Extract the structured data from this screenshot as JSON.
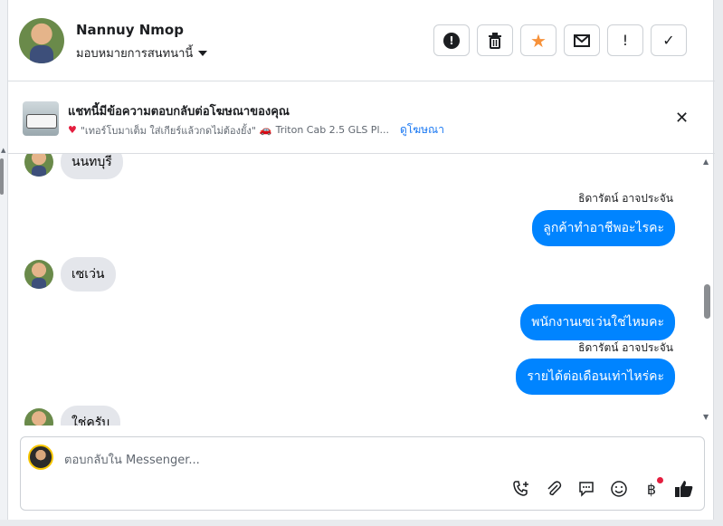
{
  "header": {
    "name": "Nannuy Nmop",
    "assign_label": "มอบหมายการสนทนานี้",
    "actions": [
      {
        "icon": "alert-circle-icon",
        "glyph": "!"
      },
      {
        "icon": "trash-icon",
        "glyph": "🗑"
      },
      {
        "icon": "star-icon",
        "glyph": "★"
      },
      {
        "icon": "mail-icon",
        "glyph": "✉"
      },
      {
        "icon": "exclamation-icon",
        "glyph": "!"
      },
      {
        "icon": "check-icon",
        "glyph": "✓"
      }
    ],
    "star_color": "#f7923a"
  },
  "ad": {
    "title": "แชทนี้มีข้อความตอบกลับต่อโฆษณาของคุณ",
    "quote": "\"เทอร์โบมาเต็ม ใส่เกียร์แล้วกดไม่ต้องยั้ง\"",
    "car": "Triton Cab 2.5 GLS Pl...",
    "link": "ดูโฆษณา"
  },
  "messages": [
    {
      "from": "them",
      "text": "นนทบุรี"
    },
    {
      "from": "me",
      "sender": "ธิดารัตน์ อาจประจัน",
      "text": "ลูกค้าทำอาชีพอะไรคะ"
    },
    {
      "from": "them",
      "text": "เซเว่น"
    },
    {
      "from": "me",
      "text": "พนักงานเซเว่นใช่ไหมคะ"
    },
    {
      "from": "me",
      "sender": "ธิดารัตน์ อาจประจัน",
      "text": "รายได้ต่อเดือนเท่าไหร่คะ"
    },
    {
      "from": "them",
      "text": "ใช่ครับ"
    }
  ],
  "composer": {
    "placeholder": "ตอบกลับใน Messenger...",
    "tools": [
      "call-add-icon",
      "paperclip-icon",
      "saved-reply-icon",
      "emoji-icon",
      "baht-icon",
      "thumbs-up-icon"
    ]
  },
  "colors": {
    "outgoing_bubble": "#0084ff",
    "incoming_bubble": "#e4e6eb",
    "link": "#1877f2"
  }
}
